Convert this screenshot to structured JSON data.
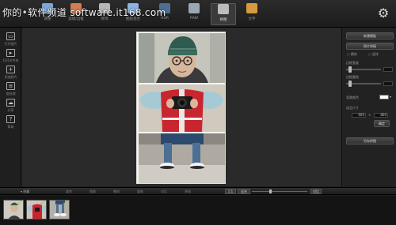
{
  "watermark": {
    "site": "你的",
    "dot": "•",
    "text": "软件频道 software.it168.com"
  },
  "toolbar": {
    "items": [
      {
        "label": "调整",
        "color": "#7aa8d8"
      },
      {
        "label": "滤镜/边框",
        "color": "#d37d53"
      },
      {
        "label": "修饰",
        "color": "#b6b6b6"
      },
      {
        "label": "图层混合",
        "color": "#8db3e0"
      },
      {
        "label": "HDR",
        "color": "#4f6e94"
      },
      {
        "label": "RAW",
        "color": "#9ba7b4"
      },
      {
        "label": "拼图",
        "color": "#bcbcbc",
        "active": true
      },
      {
        "label": "文字",
        "color": "#d69a3f"
      }
    ],
    "settings_icon": "gear-icon"
  },
  "leftbar": {
    "items": [
      {
        "label": "打开图片",
        "icon": "folder-icon",
        "glyph": "▭"
      },
      {
        "label": "打开文件夹",
        "icon": "folder-open-icon",
        "glyph": "▸"
      },
      {
        "label": "添加照片",
        "icon": "plus-icon",
        "glyph": "+"
      },
      {
        "label": "批处理",
        "icon": "monitor-icon",
        "glyph": "≡"
      },
      {
        "label": "分享",
        "icon": "cloud-icon",
        "glyph": "☁"
      },
      {
        "label": "帮助",
        "icon": "help-icon",
        "glyph": "?"
      }
    ]
  },
  "rightpanel": {
    "btn_template": "新建模板",
    "btn_stitch": "照片拼接",
    "radio_a": "横排",
    "radio_b": "竖排",
    "label_spacing": "边框宽度",
    "label_corner": "边框圆角",
    "label_bg": "背景颜色",
    "label_size": "成品尺寸",
    "width_value": "600",
    "height_value": "800",
    "btn_apply": "确定",
    "btn_save": "另存拼图"
  },
  "bottombar": {
    "collapse": "▾ 隐藏",
    "tools": [
      "旋转",
      "镜像",
      "撤销",
      "重做",
      "对比",
      "原图",
      "1:1"
    ],
    "fit": "适合",
    "compare": "对比"
  },
  "filmstrip": {
    "count": 3
  }
}
